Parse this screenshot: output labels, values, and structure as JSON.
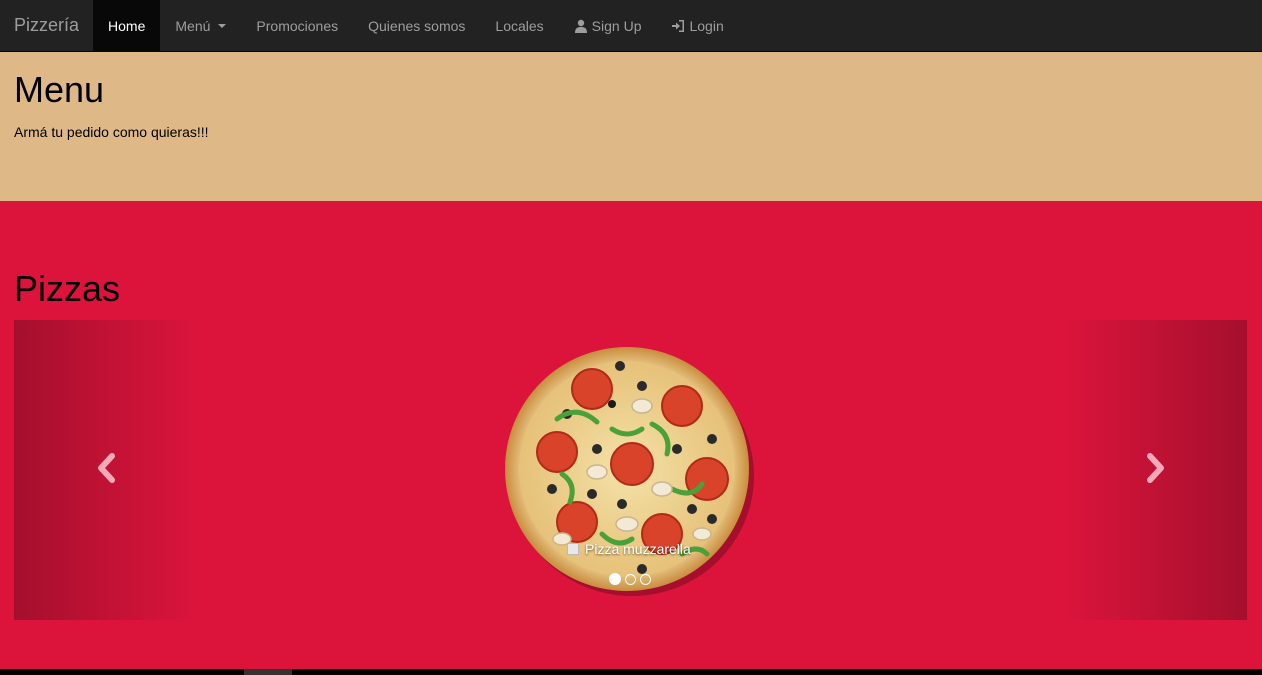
{
  "navbar": {
    "brand": "Pizzería",
    "items": [
      {
        "label": "Home",
        "active": true
      },
      {
        "label": "Menú",
        "dropdown": true
      },
      {
        "label": "Promociones"
      },
      {
        "label": "Quienes somos"
      },
      {
        "label": "Locales"
      },
      {
        "label": "Sign Up",
        "icon": "user-icon"
      },
      {
        "label": "Login",
        "icon": "login-icon"
      }
    ]
  },
  "jumbotron": {
    "title": "Menu",
    "subtitle": "Armá tu pedido como quieras!!!"
  },
  "section": {
    "title": "Pizzas"
  },
  "carousel": {
    "caption": "Pizza muzzarella",
    "active_index": 0,
    "slide_count": 3,
    "prev_icon": "chevron-left-icon",
    "next_icon": "chevron-right-icon"
  },
  "colors": {
    "navbar_bg": "#222222",
    "jumbotron_bg": "#deb887",
    "page_bg": "#dc143c"
  }
}
